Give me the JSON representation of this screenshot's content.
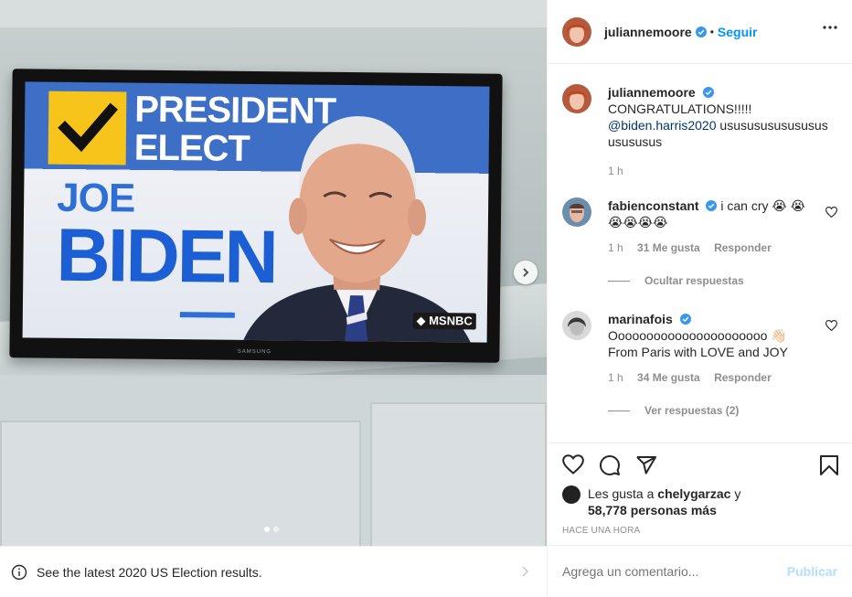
{
  "photo": {
    "banner_line1": "PRESIDENT",
    "banner_line2": "ELECT",
    "name_first": "JOE",
    "name_last": "BIDEN",
    "network_logo": "MSNBC",
    "tv_brand": "SAMSUNG",
    "carousel_index": 1,
    "carousel_total": 2
  },
  "election_bar": {
    "text": "See the latest 2020 US Election results.",
    "icon": "info-icon"
  },
  "header": {
    "username": "juliannemoore",
    "separator": "•",
    "follow_label": "Seguir"
  },
  "caption": {
    "username": "juliannemoore",
    "line1": "CONGRATULATIONS!!!!!",
    "mention": "@biden.harris2020",
    "line2_rest": " usususususususus",
    "line3": "usususus",
    "time": "1 h"
  },
  "comments": [
    {
      "username": "fabienconstant",
      "text": "i can cry 😭 😭",
      "text_line2": "😭😭😭😭",
      "time": "1 h",
      "likes": "31 Me gusta",
      "reply_label": "Responder",
      "replies_toggle": "Ocultar respuestas"
    },
    {
      "username": "marinafois",
      "text": "Oooooooooooooooooooooo 👋🏻",
      "text_line2": "From Paris with LOVE and JOY",
      "time": "1 h",
      "likes": "34 Me gusta",
      "reply_label": "Responder",
      "replies_toggle": "Ver respuestas (2)"
    }
  ],
  "likes": {
    "prefix": "Les gusta a ",
    "user": "chelygarzac",
    "suffix": " y",
    "count": "58,778 personas más"
  },
  "timeago": "HACE UNA HORA",
  "add_comment": {
    "placeholder": "Agrega un comentario...",
    "publish_label": "Publicar"
  },
  "colors": {
    "accent": "#0095f6",
    "verified": "#3897f0",
    "publish_disabled": "#b2dffc",
    "tv_blue": "#3d6fc6",
    "check_yellow": "#f6c41a"
  }
}
